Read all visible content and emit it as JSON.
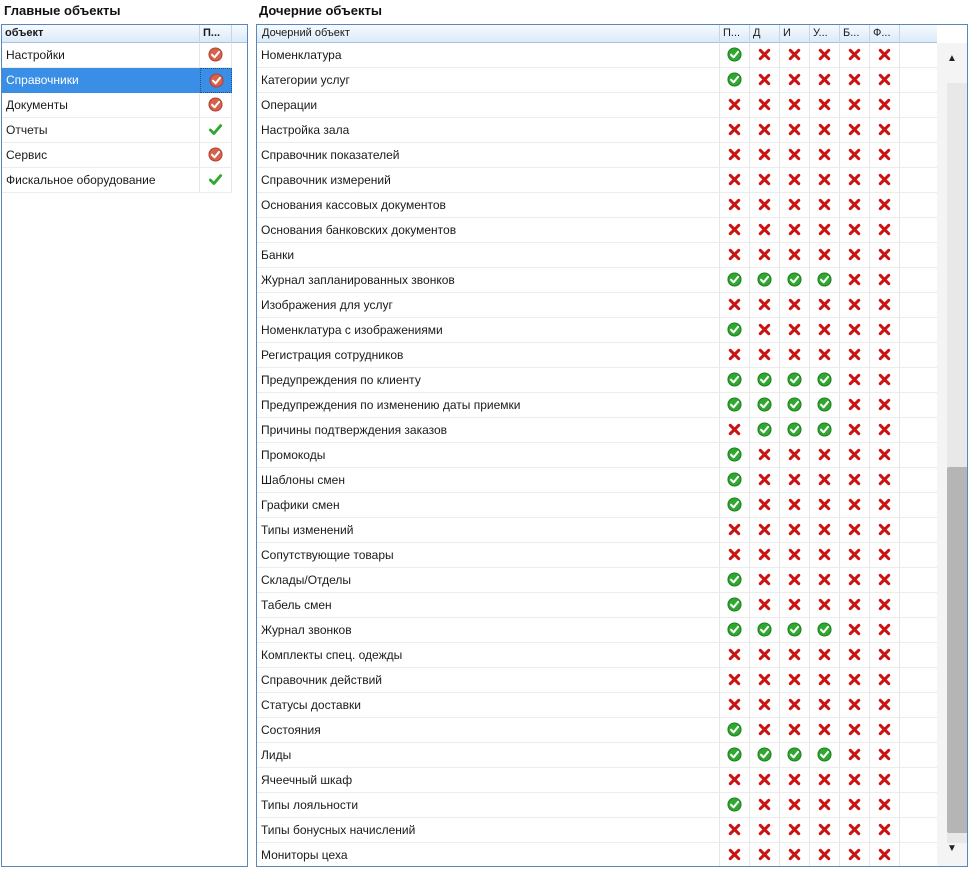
{
  "left_panel": {
    "title": "Главные объекты",
    "columns": [
      "объект",
      "П..."
    ],
    "rows": [
      {
        "name": "Настройки",
        "perm": "partial"
      },
      {
        "name": "Справочники",
        "perm": "partial",
        "selected": true
      },
      {
        "name": "Документы",
        "perm": "partial"
      },
      {
        "name": "Отчеты",
        "perm": "check"
      },
      {
        "name": "Сервис",
        "perm": "partial"
      },
      {
        "name": "Фискальное оборудование",
        "perm": "check"
      }
    ]
  },
  "right_panel": {
    "title": "Дочерние объекты",
    "columns": [
      "Дочерний объект",
      "П...",
      "Д",
      "И",
      "У...",
      "Б...",
      "Ф..."
    ],
    "rows": [
      {
        "name": "Номенклатура",
        "flags": [
          1,
          0,
          0,
          0,
          0,
          0
        ]
      },
      {
        "name": "Категории услуг",
        "flags": [
          1,
          0,
          0,
          0,
          0,
          0
        ]
      },
      {
        "name": "Операции",
        "flags": [
          0,
          0,
          0,
          0,
          0,
          0
        ]
      },
      {
        "name": "Настройка зала",
        "flags": [
          0,
          0,
          0,
          0,
          0,
          0
        ]
      },
      {
        "name": "Справочник показателей",
        "flags": [
          0,
          0,
          0,
          0,
          0,
          0
        ]
      },
      {
        "name": "Справочник измерений",
        "flags": [
          0,
          0,
          0,
          0,
          0,
          0
        ]
      },
      {
        "name": "Основания кассовых документов",
        "flags": [
          0,
          0,
          0,
          0,
          0,
          0
        ]
      },
      {
        "name": "Основания банковских документов",
        "flags": [
          0,
          0,
          0,
          0,
          0,
          0
        ]
      },
      {
        "name": "Банки",
        "flags": [
          0,
          0,
          0,
          0,
          0,
          0
        ]
      },
      {
        "name": "Журнал запланированных звонков",
        "flags": [
          1,
          1,
          1,
          1,
          0,
          0
        ]
      },
      {
        "name": "Изображения для услуг",
        "flags": [
          0,
          0,
          0,
          0,
          0,
          0
        ]
      },
      {
        "name": "Номенклатура с изображениями",
        "flags": [
          1,
          0,
          0,
          0,
          0,
          0
        ]
      },
      {
        "name": "Регистрация сотрудников",
        "flags": [
          0,
          0,
          0,
          0,
          0,
          0
        ]
      },
      {
        "name": "Предупреждения по клиенту",
        "flags": [
          1,
          1,
          1,
          1,
          0,
          0
        ]
      },
      {
        "name": "Предупреждения по изменению даты приемки",
        "flags": [
          1,
          1,
          1,
          1,
          0,
          0
        ]
      },
      {
        "name": "Причины подтверждения заказов",
        "flags": [
          0,
          1,
          1,
          1,
          0,
          0
        ]
      },
      {
        "name": "Промокоды",
        "flags": [
          1,
          0,
          0,
          0,
          0,
          0
        ]
      },
      {
        "name": "Шаблоны смен",
        "flags": [
          1,
          0,
          0,
          0,
          0,
          0
        ]
      },
      {
        "name": "Графики смен",
        "flags": [
          1,
          0,
          0,
          0,
          0,
          0
        ]
      },
      {
        "name": "Типы изменений",
        "flags": [
          0,
          0,
          0,
          0,
          0,
          0
        ]
      },
      {
        "name": "Сопутствующие товары",
        "flags": [
          0,
          0,
          0,
          0,
          0,
          0
        ]
      },
      {
        "name": "Склады/Отделы",
        "flags": [
          1,
          0,
          0,
          0,
          0,
          0
        ]
      },
      {
        "name": "Табель смен",
        "flags": [
          1,
          0,
          0,
          0,
          0,
          0
        ]
      },
      {
        "name": "Журнал звонков",
        "flags": [
          1,
          1,
          1,
          1,
          0,
          0
        ]
      },
      {
        "name": "Комплекты спец. одежды",
        "flags": [
          0,
          0,
          0,
          0,
          0,
          0
        ]
      },
      {
        "name": "Справочник действий",
        "flags": [
          0,
          0,
          0,
          0,
          0,
          0
        ]
      },
      {
        "name": "Статусы доставки",
        "flags": [
          0,
          0,
          0,
          0,
          0,
          0
        ]
      },
      {
        "name": "Состояния",
        "flags": [
          1,
          0,
          0,
          0,
          0,
          0
        ]
      },
      {
        "name": "Лиды",
        "flags": [
          1,
          1,
          1,
          1,
          0,
          0
        ]
      },
      {
        "name": "Ячеечный шкаф",
        "flags": [
          0,
          0,
          0,
          0,
          0,
          0
        ]
      },
      {
        "name": "Типы лояльности",
        "flags": [
          1,
          0,
          0,
          0,
          0,
          0
        ]
      },
      {
        "name": "Типы бонусных начислений",
        "flags": [
          0,
          0,
          0,
          0,
          0,
          0
        ]
      },
      {
        "name": "Мониторы цеха",
        "flags": [
          0,
          0,
          0,
          0,
          0,
          0
        ]
      }
    ]
  },
  "scrollbar": {
    "up_glyph": "▲",
    "down_glyph": "▼"
  },
  "icons": {
    "granted": "green-check-circle-icon",
    "denied": "red-cross-icon",
    "partial": "partial-permission-icon",
    "check": "green-checkmark-icon"
  },
  "colors": {
    "granted": "#2fa82f",
    "denied": "#cc1111",
    "partial": "#d9604a",
    "selection": "#3a8ee6",
    "frame": "#5a86b8"
  }
}
